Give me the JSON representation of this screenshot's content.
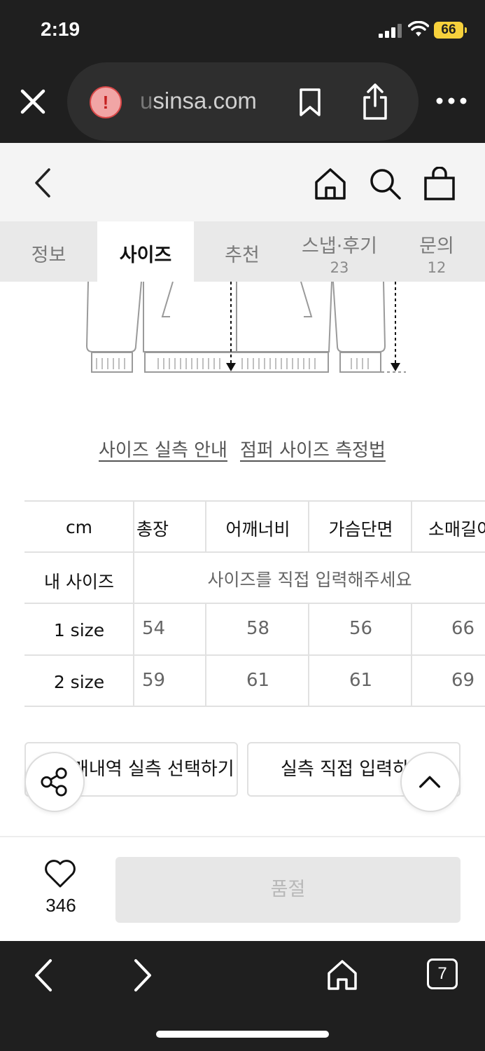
{
  "status_bar": {
    "time": "2:19",
    "battery": "66"
  },
  "browser": {
    "url_faded": "u",
    "url": "sinsa.com",
    "tab_count": "7"
  },
  "tabs": [
    {
      "label": "정보",
      "count": ""
    },
    {
      "label": "사이즈",
      "count": ""
    },
    {
      "label": "추천",
      "count": ""
    },
    {
      "label": "스냅·후기",
      "count": "23"
    },
    {
      "label": "문의",
      "count": "12"
    }
  ],
  "guide_links": {
    "size_guide": "사이즈 실측 안내",
    "measure_guide": "점퍼 사이즈 측정법"
  },
  "size_table": {
    "unit_header": "cm",
    "columns": [
      "총장",
      "어깨너비",
      "가슴단면",
      "소매길이"
    ],
    "my_size_label": "내 사이즈",
    "my_size_prompt": "사이즈를 직접 입력해주세요",
    "rows": [
      {
        "label": "1 size",
        "values": [
          "54",
          "58",
          "56",
          "66"
        ]
      },
      {
        "label": "2 size",
        "values": [
          "59",
          "61",
          "61",
          "69"
        ]
      }
    ]
  },
  "buttons": {
    "history_select": "구매내역 실측 선택하기",
    "direct_input": "실측 직접 입력하기"
  },
  "action_bar": {
    "like_count": "346",
    "soldout_label": "품절"
  },
  "colors": {
    "dark_bar": "#1f1f1f",
    "header_bg": "#f4f4f4",
    "tab_bg": "#e9e9e9",
    "battery": "#f7d13c",
    "warning": "#d94848"
  }
}
